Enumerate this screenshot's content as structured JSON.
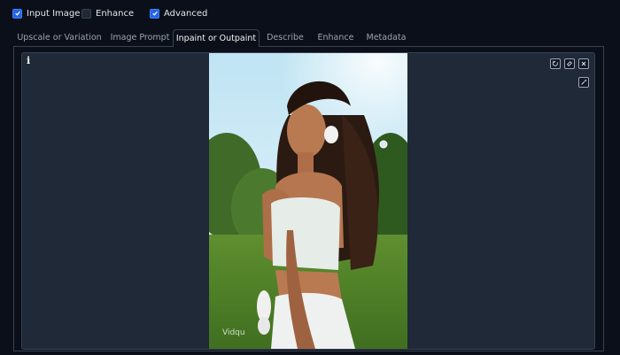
{
  "options": [
    {
      "label": "Input Image",
      "checked": true
    },
    {
      "label": "Enhance",
      "checked": false
    },
    {
      "label": "Advanced",
      "checked": true
    }
  ],
  "tabs": [
    {
      "label": "Upscale or Variation",
      "active": false
    },
    {
      "label": "Image Prompt",
      "active": false
    },
    {
      "label": "Inpaint or Outpaint",
      "active": true
    },
    {
      "label": "Describe",
      "active": false
    },
    {
      "label": "Enhance",
      "active": false
    },
    {
      "label": "Metadata",
      "active": false
    }
  ],
  "canvas": {
    "info_label": "i",
    "watermark": "Vidqu",
    "tools": [
      "undo-icon",
      "eraser-icon",
      "close-icon",
      "brush-icon"
    ]
  },
  "colors": {
    "background": "#0b0f19",
    "panel": "#1f2937",
    "accent": "#2563eb",
    "border": "#374151"
  }
}
